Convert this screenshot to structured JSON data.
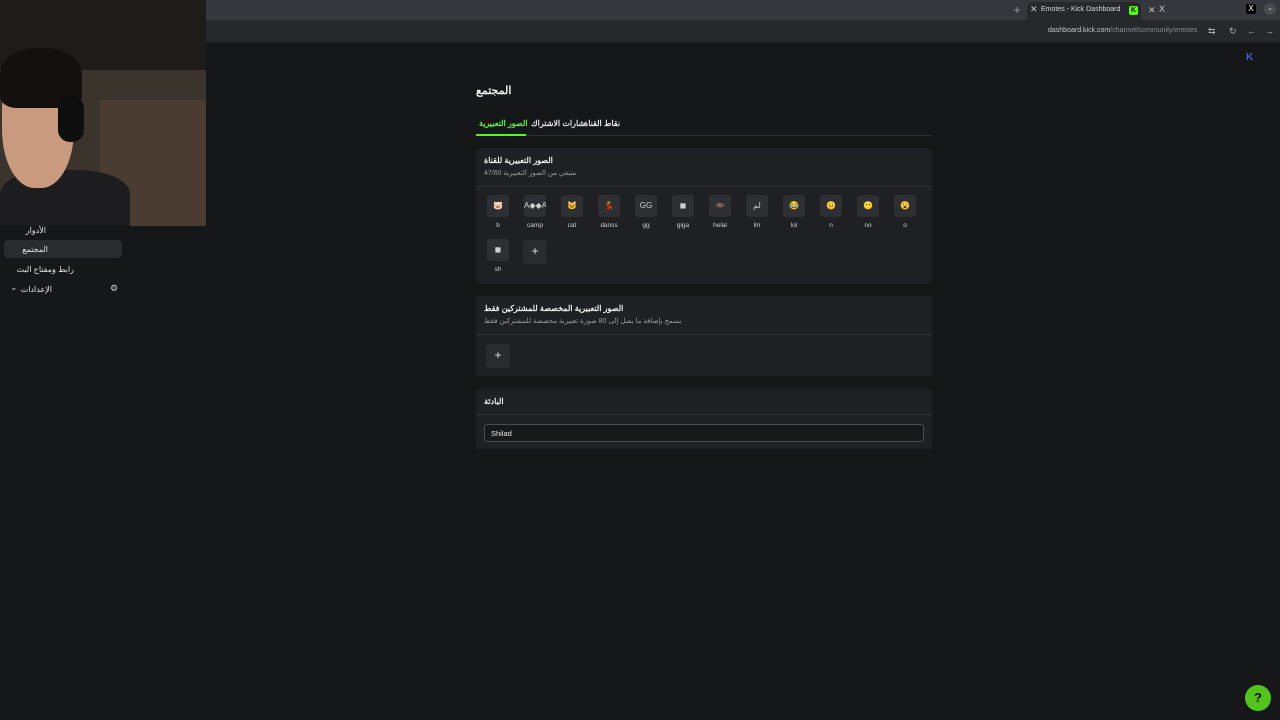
{
  "browser": {
    "new_tab_icon": "+",
    "tab_title": "Emotes - Kick Dashboard",
    "tab_favicon": "K",
    "tab2_close": "X",
    "tab2_favicon": "X",
    "x_logo": "X",
    "url_host": "dashboard.kick.com",
    "url_path": "/channel/community/emotes"
  },
  "sidebar": {
    "items": [
      {
        "label": "الأدوار"
      },
      {
        "label": "المجتمع"
      },
      {
        "label": "رابط ومفتاح البث"
      },
      {
        "label": "الإعدادات"
      }
    ]
  },
  "main": {
    "title": "المجتمع",
    "tabs": [
      {
        "label": "الصور التعبيرية"
      },
      {
        "label": "شارات الاشتراك"
      },
      {
        "label": "نقاط القناة"
      }
    ]
  },
  "channel_emotes": {
    "title": "الصور التعبيرية للقناة",
    "subtitle": "متبقي من الصور التعبيرية 47/60",
    "emotes": [
      {
        "name": "b",
        "glyph": "🐷"
      },
      {
        "name": "camp",
        "glyph": "A◆◆A"
      },
      {
        "name": "cat",
        "glyph": "🐱"
      },
      {
        "name": "danss",
        "glyph": "💃"
      },
      {
        "name": "gg",
        "glyph": "GG"
      },
      {
        "name": "giga",
        "glyph": "◼"
      },
      {
        "name": "helal",
        "glyph": "🦇"
      },
      {
        "name": "lm",
        "glyph": "لم"
      },
      {
        "name": "lol",
        "glyph": "😂"
      },
      {
        "name": "n",
        "glyph": "😐"
      },
      {
        "name": "no",
        "glyph": "😶"
      },
      {
        "name": "o",
        "glyph": "😮"
      },
      {
        "name": "sh",
        "glyph": "◼"
      }
    ],
    "add_label": "+"
  },
  "sub_emotes": {
    "title": "الصور التعبيرية المخصصة للمشتركين فقط",
    "subtitle": "يسمح بإضافة ما يصل إلى 80 صورة تعبيرية مخصصة للمشتركين فقط",
    "add_label": "+"
  },
  "prefix": {
    "title": "البادئة",
    "value": "Shilad"
  },
  "help_icon_glyph": "?"
}
